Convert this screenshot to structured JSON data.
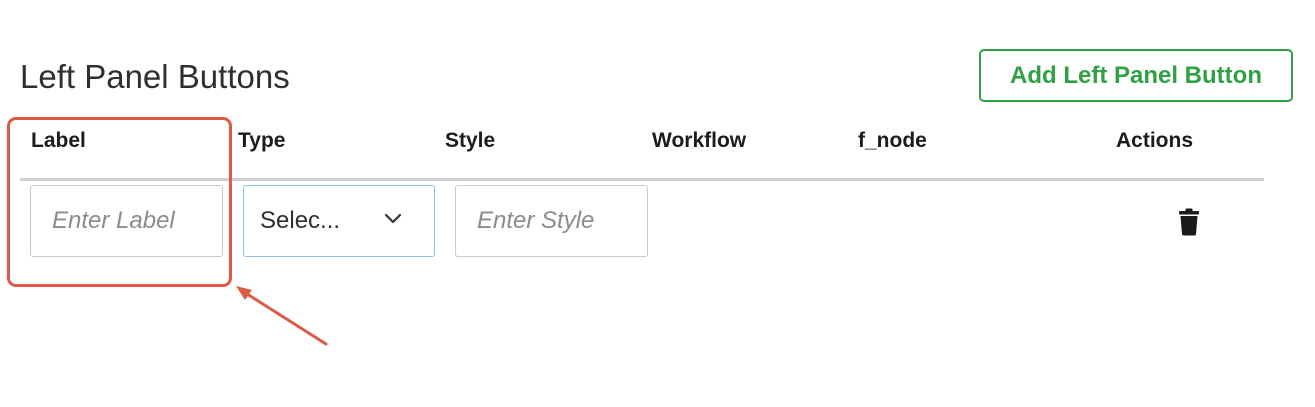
{
  "section": {
    "title": "Left Panel Buttons",
    "add_button_label": "Add Left Panel Button"
  },
  "table": {
    "columns": [
      "Label",
      "Type",
      "Style",
      "Workflow",
      "f_node",
      "Actions"
    ],
    "rows": [
      {
        "label_placeholder": "Enter Label",
        "type_value": "Selec...",
        "style_placeholder": "Enter Style",
        "action_icon": "trash-icon"
      }
    ]
  },
  "annotation": {
    "highlight_color": "#dd5a44",
    "target": "label-column"
  },
  "colors": {
    "accent_green": "#2fa144",
    "focus_blue": "#8ec1e8",
    "annotation_red": "#dd5a44"
  }
}
